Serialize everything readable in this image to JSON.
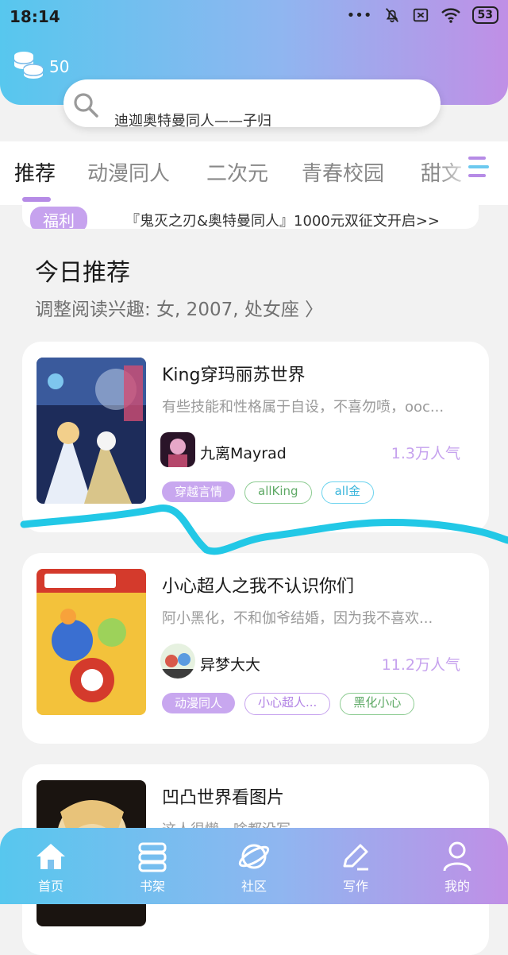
{
  "status_bar": {
    "time": "18:14",
    "battery": "53"
  },
  "header": {
    "coin_count": "50"
  },
  "search": {
    "ghost_text": "",
    "placeholder": "迪迦奥特曼同人——子归"
  },
  "tabs": [
    {
      "label": "推荐",
      "active": true
    },
    {
      "label": "动漫同人",
      "active": false
    },
    {
      "label": "二次元",
      "active": false
    },
    {
      "label": "青春校园",
      "active": false
    },
    {
      "label": "甜文",
      "active": false
    }
  ],
  "notice": {
    "badge": "福利",
    "text": "『鬼灭之刃&奥特曼同人』1000元双征文开启>>"
  },
  "section": {
    "title": "今日推荐",
    "subtitle": "调整阅读兴趣: 女, 2007, 处女座",
    "chevron": "〉"
  },
  "books": [
    {
      "title": "King穿玛丽苏世界",
      "desc": "有些技能和性格属于自设，不喜勿喷，ooc...",
      "author": "九离Mayrad",
      "popularity": "1.3万人气",
      "tags": [
        "穿越言情",
        "allKing",
        "all金"
      ]
    },
    {
      "title": "小心超人之我不认识你们",
      "desc": "阿小黑化，不和伽爷结婚，因为我不喜欢...",
      "author": "异梦大大",
      "popularity": "11.2万人气",
      "tags": [
        "动漫同人",
        "小心超人...",
        "黑化小心"
      ]
    },
    {
      "title": "凹凸世界看图片",
      "desc": "这人很懒，啥都没写",
      "author": "",
      "popularity": "",
      "tags": []
    }
  ],
  "nav": [
    {
      "label": "首页",
      "icon": "home-icon",
      "active": true
    },
    {
      "label": "书架",
      "icon": "bookshelf-icon",
      "active": false
    },
    {
      "label": "社区",
      "icon": "planet-icon",
      "active": false
    },
    {
      "label": "写作",
      "icon": "pen-icon",
      "active": false
    },
    {
      "label": "我的",
      "icon": "user-icon",
      "active": false
    }
  ],
  "colors": {
    "accent_blue": "#57c7ee",
    "accent_purple": "#c08fe6",
    "tag_purple": "#c8a7ef",
    "tag_green": "#8ccb91",
    "tag_blue": "#6cd3ee",
    "squiggle": "#22c8e6"
  }
}
